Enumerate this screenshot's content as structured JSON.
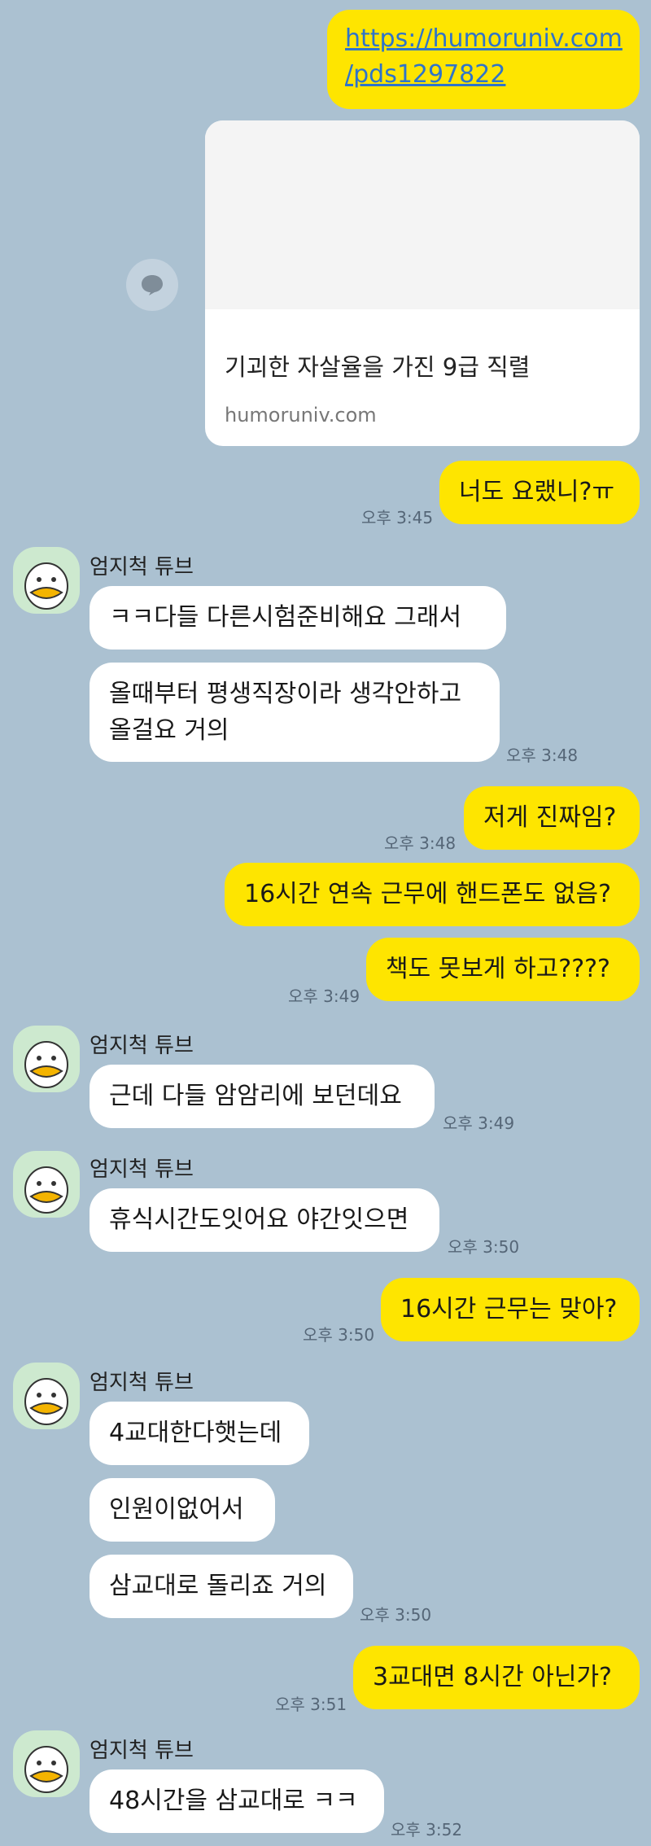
{
  "chat": {
    "sender_name": "엄지척 튜브",
    "link": {
      "url_line1": "https://humoruniv.com",
      "url_line2": "/pds1297822",
      "card_title": "기괴한 자살율을 가진 9급 직렬",
      "card_domain": "humoruniv.com"
    },
    "messages": {
      "m1": "너도 요랬니?ㅠ",
      "m2": "ㅋㅋ다들 다른시험준비해요  그래서",
      "m3_l1": "올때부터 평생직장이라 생각안하고",
      "m3_l2": "올걸요 거의",
      "m4": "저게 진짜임?",
      "m5": "16시간 연속 근무에 핸드폰도 없음?",
      "m6": "책도 못보게 하고????",
      "m7": "근데 다들 암암리에 보던데요",
      "m8": "휴식시간도잇어요 야간잇으면",
      "m9": "16시간 근무는 맞아?",
      "m10": "4교대한다햇는데",
      "m11": "인원이없어서",
      "m12": "삼교대로 돌리죠 거의",
      "m13": "3교대면 8시간 아닌가?",
      "m14": "48시간을 삼교대로 ㅋㅋ"
    },
    "times": {
      "t1": "오후 3:45",
      "t2": "오후 3:48",
      "t3": "오후 3:48",
      "t4": "오후 3:49",
      "t5": "오후 3:49",
      "t6": "오후 3:50",
      "t7": "오후 3:50",
      "t8": "오후 3:50",
      "t9": "오후 3:51",
      "t10": "오후 3:52"
    }
  }
}
